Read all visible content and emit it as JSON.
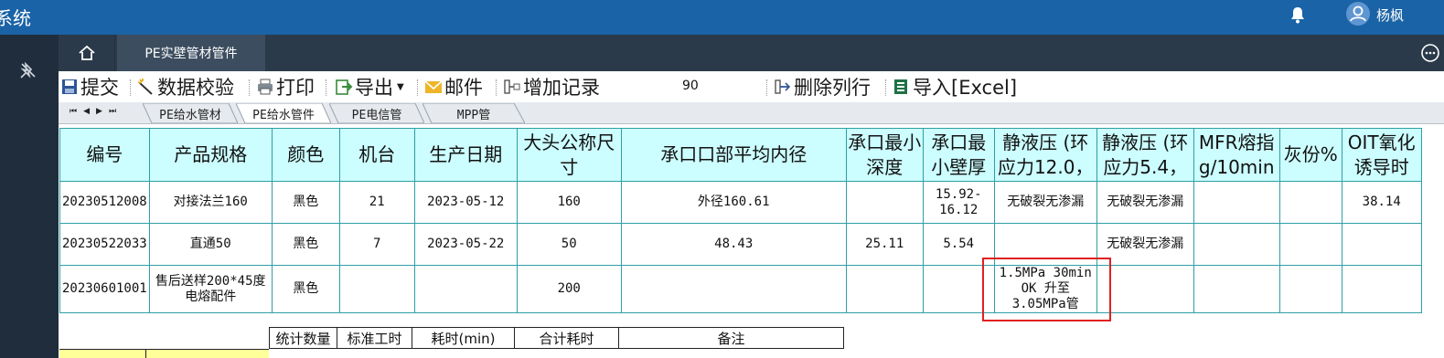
{
  "app": {
    "title_fragment": "系统",
    "user": "杨枫"
  },
  "nav": {
    "page_tab": "PE实壁管材管件"
  },
  "toolbar": {
    "submit": "提交",
    "validate": "数据校验",
    "print": "打印",
    "export": "导出",
    "mail": "邮件",
    "add_record": "增加记录",
    "value": "90",
    "delete_row": "删除列行",
    "import": "导入[Excel]"
  },
  "sheets": [
    "PE给水管材",
    "PE给水管件",
    "PE电信管",
    "MPP管"
  ],
  "active_sheet": "PE给水管件",
  "table": {
    "headers": [
      "编号",
      "产品规格",
      "颜色",
      "机台",
      "生产日期",
      "大头公称尺寸",
      "承口口部平均内径",
      "承口最小深度",
      "承口最小壁厚",
      "静液压 (环应力12.0，",
      "静液压 (环应力5.4，",
      "MFR熔指g/10min",
      "灰份%",
      "OIT氧化诱导时"
    ],
    "rows": [
      [
        "20230512008",
        "对接法兰160",
        "黑色",
        "21",
        "2023-05-12",
        "160",
        "外径160.61",
        "",
        "15.92-16.12",
        "无破裂无渗漏",
        "无破裂无渗漏",
        "",
        "",
        "38.14"
      ],
      [
        "20230522033",
        "直通50",
        "黑色",
        "7",
        "2023-05-22",
        "50",
        "48.43",
        "25.11",
        "5.54",
        "",
        "无破裂无渗漏",
        "",
        "",
        ""
      ],
      [
        "20230601001",
        "售后送样200*45度电熔配件",
        "黑色",
        "",
        "",
        "200",
        "",
        "",
        "",
        "1.5MPa 30min OK 升至3.05MPa管",
        "",
        "",
        "",
        ""
      ]
    ]
  },
  "summary": {
    "headers": [
      "统计数量",
      "标准工时",
      "耗时(min)",
      "合计耗时",
      "备注"
    ]
  },
  "colors": {
    "topbar": "#1a63a6",
    "sidebar": "#1f2d3d",
    "header_fill": "#ccfdff",
    "grid_border": "#2e9fa6",
    "highlight": "#e02020"
  }
}
